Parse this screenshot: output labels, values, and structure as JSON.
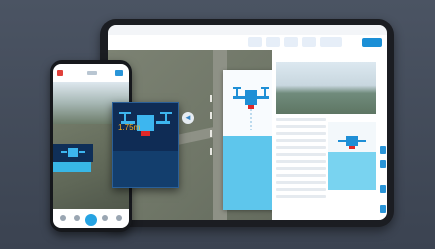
{
  "colors": {
    "background": "#3f4754",
    "accent_blue": "#1b8fd6",
    "sky_blue": "#5ec6ec",
    "popup_navy": "#0e2b52",
    "warning_red": "#e02828",
    "distance_orange": "#ffb21e"
  },
  "tablet": {
    "start_button_label": ""
  },
  "popup": {
    "distance": "1.75m",
    "alert": ""
  },
  "icons": [
    "drone-icon",
    "locate-icon",
    "arrow-icon",
    "home-icon",
    "camera-icon"
  ]
}
